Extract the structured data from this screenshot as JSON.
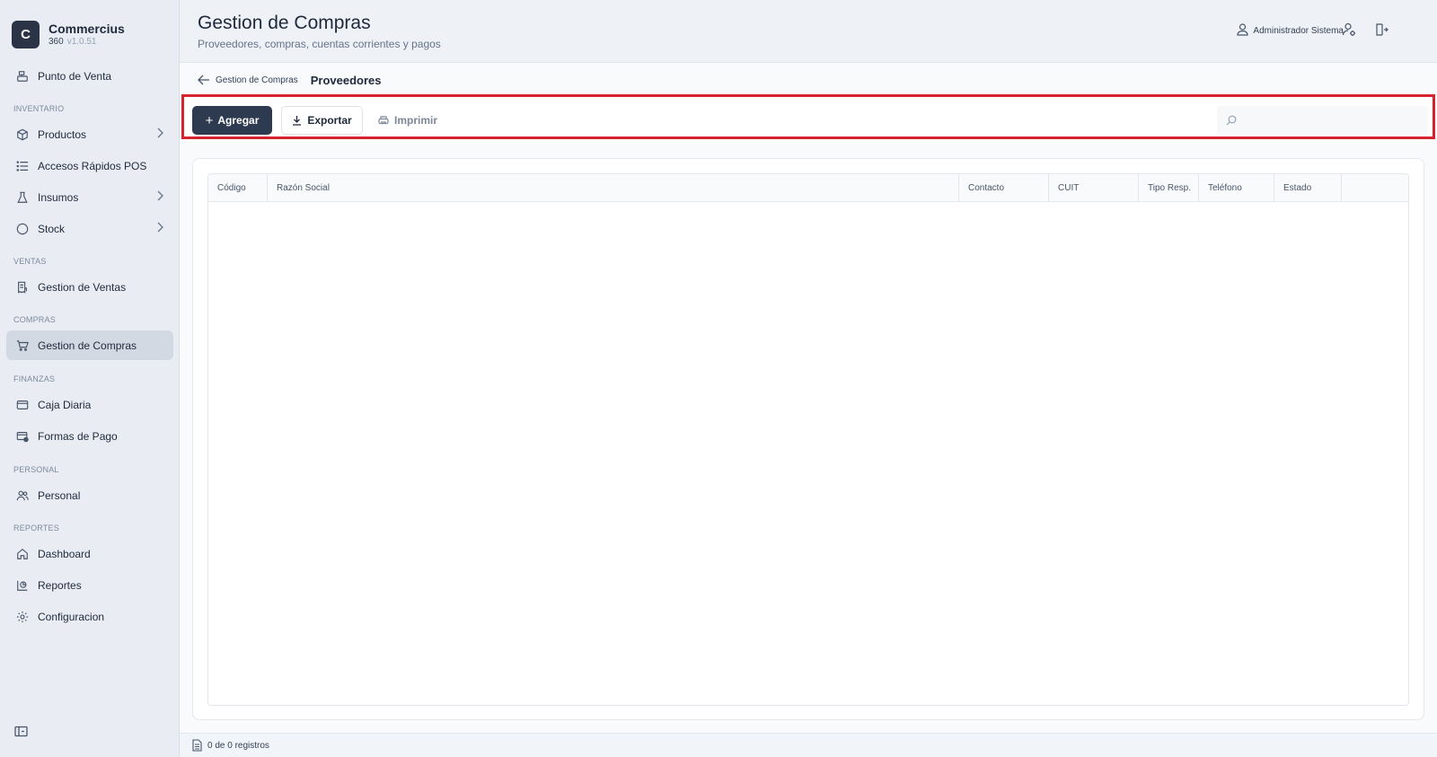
{
  "brand": {
    "logo_letter": "C",
    "name": "Commercius",
    "sub": "360",
    "version": "v1.0.51"
  },
  "sidebar": {
    "items": [
      {
        "label": "Punto de Venta",
        "icon": "cash-register-icon"
      },
      {
        "label": "Productos",
        "icon": "box-icon"
      },
      {
        "label": "Accesos Rápidos POS",
        "icon": "list-icon"
      },
      {
        "label": "Insumos",
        "icon": "flask-icon"
      },
      {
        "label": "Stock",
        "icon": "circle-icon"
      },
      {
        "label": "Gestion de Ventas",
        "icon": "receipt-icon"
      },
      {
        "label": "Gestion de Compras",
        "icon": "cart-icon"
      },
      {
        "label": "Caja Diaria",
        "icon": "wallet-icon"
      },
      {
        "label": "Formas de Pago",
        "icon": "card-icon"
      },
      {
        "label": "Personal",
        "icon": "users-icon"
      },
      {
        "label": "Dashboard",
        "icon": "home-icon"
      },
      {
        "label": "Reportes",
        "icon": "report-icon"
      },
      {
        "label": "Configuracion",
        "icon": "gear-icon"
      }
    ],
    "sections": {
      "inventario": "INVENTARIO",
      "ventas": "VENTAS",
      "compras": "COMPRAS",
      "finanzas": "FINANZAS",
      "personal": "PERSONAL",
      "reportes": "REPORTES"
    }
  },
  "header": {
    "title": "Gestion de Compras",
    "subtitle": "Proveedores, compras, cuentas corrientes y pagos",
    "user": "Administrador Sistema"
  },
  "breadcrumb": {
    "parent": "Gestion de Compras",
    "current": "Proveedores"
  },
  "toolbar": {
    "add_label": "Agregar",
    "export_label": "Exportar",
    "print_label": "Imprimir",
    "search_placeholder": ""
  },
  "table": {
    "columns": [
      "Código",
      "Razón Social",
      "Contacto",
      "CUIT",
      "Tipo Resp.",
      "Teléfono",
      "Estado",
      ""
    ]
  },
  "footer": {
    "records": "0 de 0 registros"
  },
  "colors": {
    "accent": "#2e3a4f",
    "highlight": "#d7222f",
    "active_nav": "#d2d9e3"
  }
}
